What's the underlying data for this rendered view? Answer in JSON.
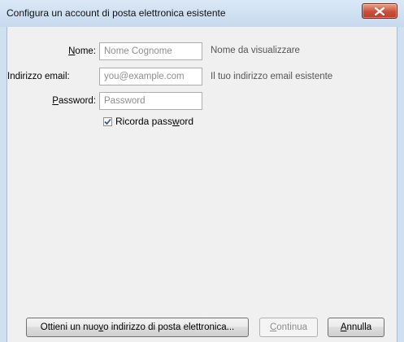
{
  "dialog": {
    "title": "Configura un account di posta elettronica esistente"
  },
  "form": {
    "name_label": "Nome:",
    "name_placeholder": "Nome Cognome",
    "name_hint": "Nome da visualizzare",
    "email_label": "Indirizzo email:",
    "email_placeholder": "you@example.com",
    "email_hint": "Il tuo indirizzo email esistente",
    "password_label": "Password:",
    "password_placeholder": "Password",
    "remember_label": "Ricorda password",
    "remember_checked": true
  },
  "buttons": {
    "new_address": "Ottieni un nuovo indirizzo di posta elettronica...",
    "continue": "Continua",
    "cancel": "Annulla"
  }
}
